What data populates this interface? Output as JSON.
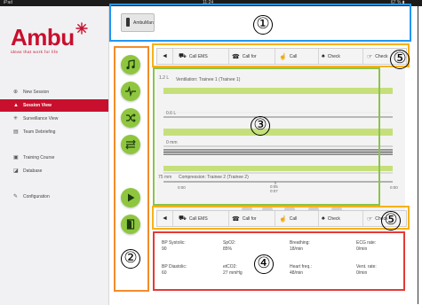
{
  "status_bar": {
    "left": "iPad",
    "center": "11:24",
    "right": "67 % ▮"
  },
  "brand": {
    "name": "Ambu",
    "tagline": "ideas that work for life"
  },
  "nav": [
    {
      "label": "New Session",
      "icon": "plus-circle-icon",
      "active": false
    },
    {
      "label": "Session View",
      "icon": "person-icon",
      "active": true
    },
    {
      "label": "Surveillance View",
      "icon": "eye-icon",
      "active": false
    },
    {
      "label": "Team Debriefing",
      "icon": "document-icon",
      "active": false
    },
    {
      "label": "Training Course",
      "icon": "course-icon",
      "active": false
    },
    {
      "label": "Database",
      "icon": "database-icon",
      "active": false
    },
    {
      "label": "Configuration",
      "icon": "wrench-icon",
      "active": false
    }
  ],
  "header": {
    "device_button": "AmbuMan"
  },
  "toolbar": {
    "back": "◄",
    "items": [
      {
        "label": "Call EMS",
        "icon": "ambulance-icon"
      },
      {
        "label": "Call for",
        "icon": "phone-icon"
      },
      {
        "label": "Call",
        "icon": "hand-icon"
      },
      {
        "label": "Check",
        "icon": "lungs-icon"
      },
      {
        "label": "Check",
        "icon": "pointing-hand-icon"
      }
    ]
  },
  "chart": {
    "y_top": "1.2 L",
    "ventilation_label": "Ventilation: Trainee 1 (Trainee 1)",
    "y_mid": "0.6 L",
    "y_bottom": "0 mm",
    "compression_depth": "75 mm",
    "compression_label": "Compression: Trainee 2 (Trainee 2)",
    "time_start": "0:00",
    "time_mid": "0:05",
    "time_end": "0:07",
    "time_right": "0:00"
  },
  "vitals": [
    {
      "label": "BP Systolic:",
      "value": "90"
    },
    {
      "label": "SpO2:",
      "value": "85%"
    },
    {
      "label": "Breathing:",
      "value": "18/min"
    },
    {
      "label": "ECG rate:",
      "value": "0/min"
    },
    {
      "label": "BP Diastolic:",
      "value": "60"
    },
    {
      "label": "etCO2:",
      "value": "27 mmHg"
    },
    {
      "label": "Heart freq.:",
      "value": "48/min"
    },
    {
      "label": "Vent. rate:",
      "value": "0/min"
    }
  ],
  "callouts": [
    "①",
    "②",
    "③",
    "④",
    "⑤",
    "⑤"
  ],
  "colors": {
    "brand_red": "#c8102e",
    "tool_green": "#8fc63f",
    "callout_blue": "#2196f3",
    "callout_orange": "#f28c28",
    "callout_green": "#8bc34a",
    "callout_red": "#e53935",
    "callout_yellow": "#f6b21b",
    "vent_band": "#c5e07a"
  }
}
